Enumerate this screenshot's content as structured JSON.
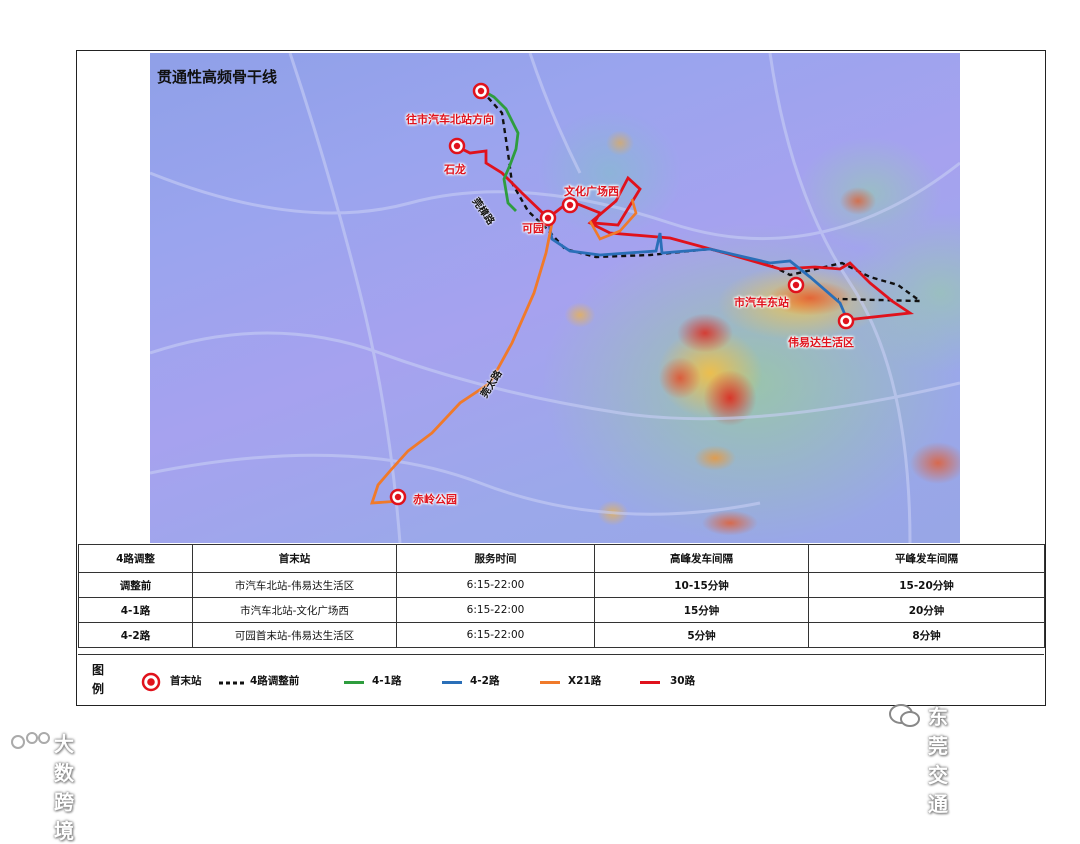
{
  "map": {
    "title": "贯通性高频骨干线",
    "stops": {
      "north": "往市汽车北站方向",
      "shijie": "石龙",
      "wenhua": "文化广场西",
      "keyuan": "可园",
      "east": "市汽车东站",
      "weiyida": "伟易达生活区",
      "chiling": "赤岭公园"
    },
    "roads": {
      "road1": "莞樟路",
      "road2": "莞太路"
    }
  },
  "table": {
    "headers": [
      "4路调整",
      "首末站",
      "服务时间",
      "高峰发车间隔",
      "平峰发车间隔"
    ],
    "rows": [
      [
        "调整前",
        "市汽车北站-伟易达生活区",
        "6:15-22:00",
        "10-15分钟",
        "15-20分钟"
      ],
      [
        "4-1路",
        "市汽车北站-文化广场西",
        "6:15-22:00",
        "15分钟",
        "20分钟"
      ],
      [
        "4-2路",
        "可园首末站-伟易达生活区",
        "6:15-22:00",
        "5分钟",
        "8分钟"
      ]
    ]
  },
  "legend": {
    "title": "图例",
    "items": [
      {
        "label": "首末站",
        "icon": "terminal-stop-icon"
      },
      {
        "label": "4路调整前",
        "color": "#111111",
        "style": "dashed"
      },
      {
        "label": "4-1路",
        "color": "#2e9d3e"
      },
      {
        "label": "4-2路",
        "color": "#2a6fb8"
      },
      {
        "label": "X21路",
        "color": "#f07a2a"
      },
      {
        "label": "30路",
        "color": "#e0121c"
      }
    ]
  },
  "watermarks": {
    "publisher": "东莞交通",
    "source": "大数跨境"
  }
}
